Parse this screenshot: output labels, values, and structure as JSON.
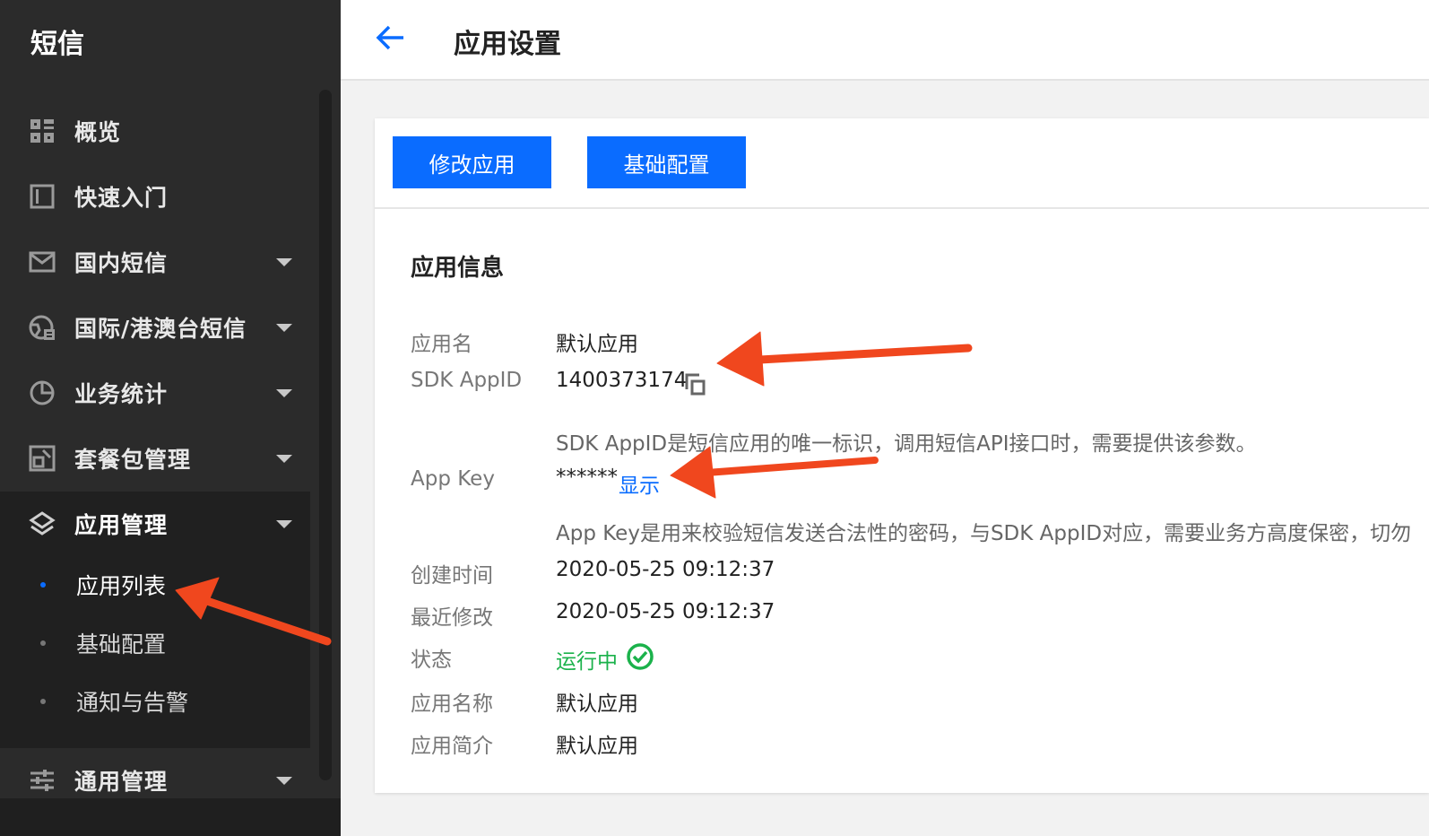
{
  "sidebar": {
    "title": "短信",
    "items": [
      {
        "label": "概览",
        "icon": "grid-icon"
      },
      {
        "label": "快速入门",
        "icon": "book-icon"
      },
      {
        "label": "国内短信",
        "icon": "mail-icon"
      },
      {
        "label": "国际/港澳台短信",
        "icon": "globe-icon"
      },
      {
        "label": "业务统计",
        "icon": "pie-chart-icon"
      },
      {
        "label": "套餐包管理",
        "icon": "package-icon"
      },
      {
        "label": "应用管理",
        "icon": "layers-icon"
      },
      {
        "label": "通用管理",
        "icon": "sliders-icon"
      }
    ],
    "submenu": [
      {
        "label": "应用列表"
      },
      {
        "label": "基础配置"
      },
      {
        "label": "通知与告警"
      }
    ]
  },
  "header": {
    "title": "应用设置"
  },
  "toolbar": {
    "edit_label": "修改应用",
    "config_label": "基础配置"
  },
  "info": {
    "section_title": "应用信息",
    "app_name_label": "应用名",
    "app_name_value": "默认应用",
    "sdk_appid_label": "SDK AppID",
    "sdk_appid_value": "1400373174",
    "sdk_appid_hint": "SDK AppID是短信应用的唯一标识，调用短信API接口时，需要提供该参数。",
    "app_key_label": "App Key",
    "app_key_value": "******",
    "app_key_show": "显示",
    "app_key_hint": "App Key是用来校验短信发送合法性的密码，与SDK AppID对应，需要业务方高度保密，切勿",
    "created_label": "创建时间",
    "created_value": "2020-05-25 09:12:37",
    "modified_label": "最近修改",
    "modified_value": "2020-05-25 09:12:37",
    "status_label": "状态",
    "status_value": "运行中",
    "full_name_label": "应用名称",
    "full_name_value": "默认应用",
    "intro_label": "应用简介",
    "intro_value": "默认应用"
  },
  "colors": {
    "accent": "#0a6cff",
    "success": "#1bb24b",
    "annotation": "#f0471e"
  }
}
